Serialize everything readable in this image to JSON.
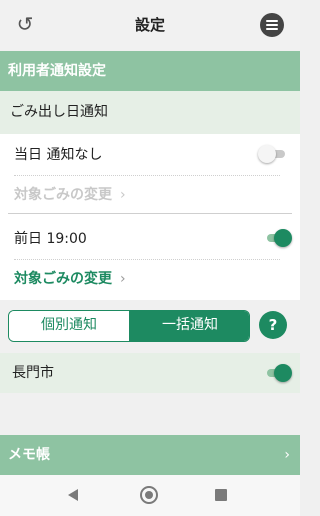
{
  "header": {
    "title": "設定",
    "back_icon": "undo-arrow-icon",
    "menu_icon": "hamburger-menu-icon"
  },
  "sections": {
    "user_settings": "利用者通知設定",
    "memo": "メモ帳"
  },
  "garbage_day": {
    "heading": "ごみ出し日通知",
    "same_day": {
      "label": "当日 通知なし",
      "enabled": false,
      "target_link": "対象ごみの変更",
      "target_enabled": false
    },
    "day_before": {
      "label": "前日 19:00",
      "enabled": true,
      "target_link": "対象ごみの変更",
      "target_enabled": true
    }
  },
  "mode_switch": {
    "options": [
      "個別通知",
      "一括通知"
    ],
    "selected": "一括通知",
    "help_label": "?"
  },
  "city": {
    "name": "長門市",
    "enabled": true
  },
  "colors": {
    "accent": "#1d8a61",
    "section_bar": "#8ec3a2",
    "subhead_bg": "#e6efe6",
    "disabled_text": "#c8c8c8"
  },
  "nav": {
    "back": "nav-back-icon",
    "home": "nav-home-icon",
    "recent": "nav-recent-icon"
  }
}
